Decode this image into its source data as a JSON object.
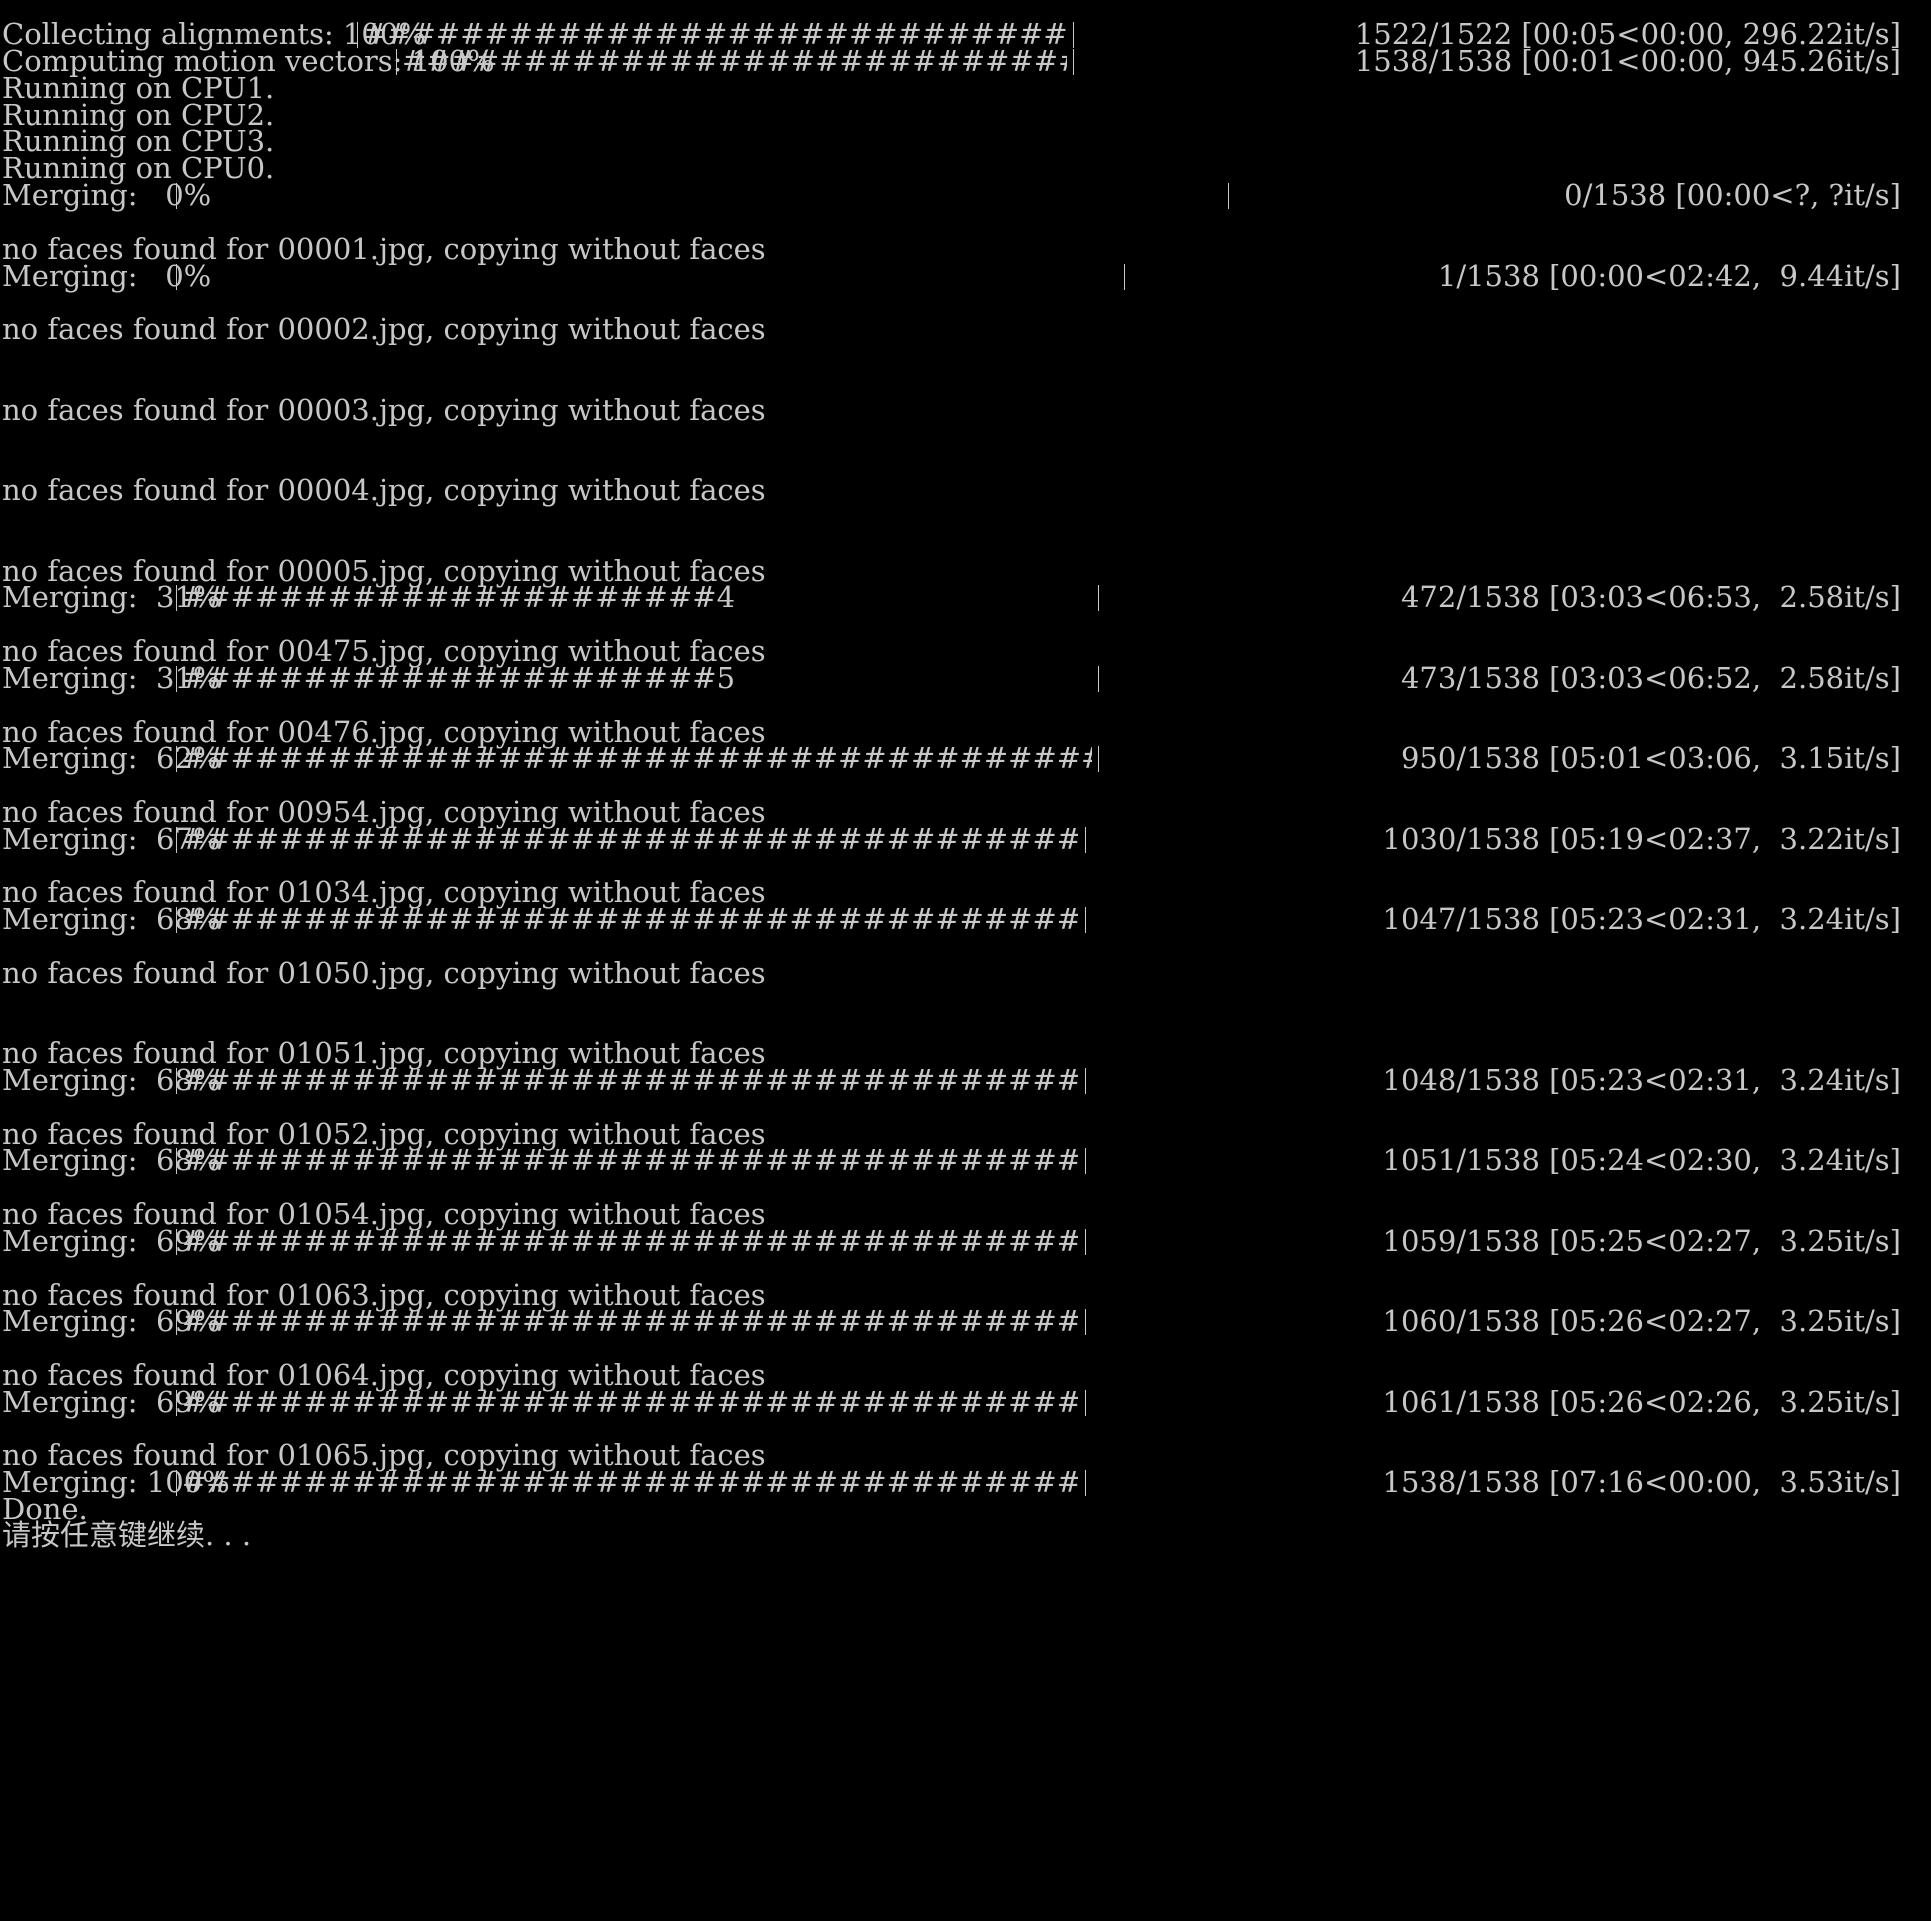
{
  "console": {
    "background": "#000000",
    "foreground": "#c7c7c7",
    "bars": [
      {
        "prefix": "Collecting alignments: 100%",
        "fill": "########################################################",
        "stats": "1522/1522 [00:05<00:00, 296.22it/s]",
        "progress": 1.0
      },
      {
        "prefix": "Computing motion vectors: 100%",
        "fill": "#####################################################",
        "stats": "1538/1538 [00:01<00:00, 945.26it/s]",
        "progress": 1.0
      }
    ],
    "cpu_lines": [
      "Running on CPU1.",
      "Running on CPU2.",
      "Running on CPU3.",
      "Running on CPU0."
    ],
    "merge_start": [
      {
        "prefix": "Merging:   0%",
        "fill": "",
        "stats": "0/1538 [00:00<?, ?it/s]",
        "progress": 0.0
      }
    ],
    "messages": [
      "no faces found for 00001.jpg, copying without faces",
      "no faces found for 00002.jpg, copying without faces",
      "no faces found for 00003.jpg, copying without faces",
      "no faces found for 00004.jpg, copying without faces",
      "no faces found for 00005.jpg, copying without faces",
      "no faces found for 00475.jpg, copying without faces",
      "no faces found for 00476.jpg, copying without faces",
      "no faces found for 00954.jpg, copying without faces",
      "no faces found for 01034.jpg, copying without faces",
      "no faces found for 01050.jpg, copying without faces",
      "no faces found for 01051.jpg, copying without faces",
      "no faces found for 01052.jpg, copying without faces",
      "no faces found for 01054.jpg, copying without faces",
      "no faces found for 01063.jpg, copying without faces",
      "no faces found for 01064.jpg, copying without faces",
      "no faces found for 01065.jpg, copying without faces"
    ],
    "merging": [
      {
        "prefix": "Merging:   0%",
        "fill": "",
        "stats": "1/1538 [00:00<02:42,  9.44it/s]",
        "progress": 0.0
      },
      {
        "prefix": "Merging:  31%",
        "fill": "######################4",
        "stats": "472/1538 [03:03<06:53,  2.58it/s]",
        "progress": 0.31
      },
      {
        "prefix": "Merging:  31%",
        "fill": "######################5",
        "stats": "473/1538 [03:03<06:52,  2.58it/s]",
        "progress": 0.31
      },
      {
        "prefix": "Merging:  62%",
        "fill": "############################################2",
        "stats": "950/1538 [05:01<03:06,  3.15it/s]",
        "progress": 0.62
      },
      {
        "prefix": "Merging:  67%",
        "fill": "###############################################2",
        "stats": "1030/1538 [05:19<02:37,  3.22it/s]",
        "progress": 0.67
      },
      {
        "prefix": "Merging:  68%",
        "fill": "###############################################9",
        "stats": "1047/1538 [05:23<02:31,  3.24it/s]",
        "progress": 0.68
      },
      {
        "prefix": "Merging:  68%",
        "fill": "################################################",
        "stats": "1048/1538 [05:23<02:31,  3.24it/s]",
        "progress": 0.68
      },
      {
        "prefix": "Merging:  68%",
        "fill": "################################################1",
        "stats": "1051/1538 [05:24<02:30,  3.24it/s]",
        "progress": 0.68
      },
      {
        "prefix": "Merging:  69%",
        "fill": "################################################5",
        "stats": "1059/1538 [05:25<02:27,  3.25it/s]",
        "progress": 0.69
      },
      {
        "prefix": "Merging:  69%",
        "fill": "################################################5",
        "stats": "1060/1538 [05:26<02:27,  3.25it/s]",
        "progress": 0.69
      },
      {
        "prefix": "Merging:  69%",
        "fill": "################################################6",
        "stats": "1061/1538 [05:26<02:26,  3.25it/s]",
        "progress": 0.69
      },
      {
        "prefix": "Merging: 100%",
        "fill": "#####################################################################",
        "stats": "1538/1538 [07:16<00:00,  3.53it/s]",
        "progress": 1.0
      }
    ],
    "done": "Done.",
    "prompt": "请按任意键继续. . ."
  }
}
